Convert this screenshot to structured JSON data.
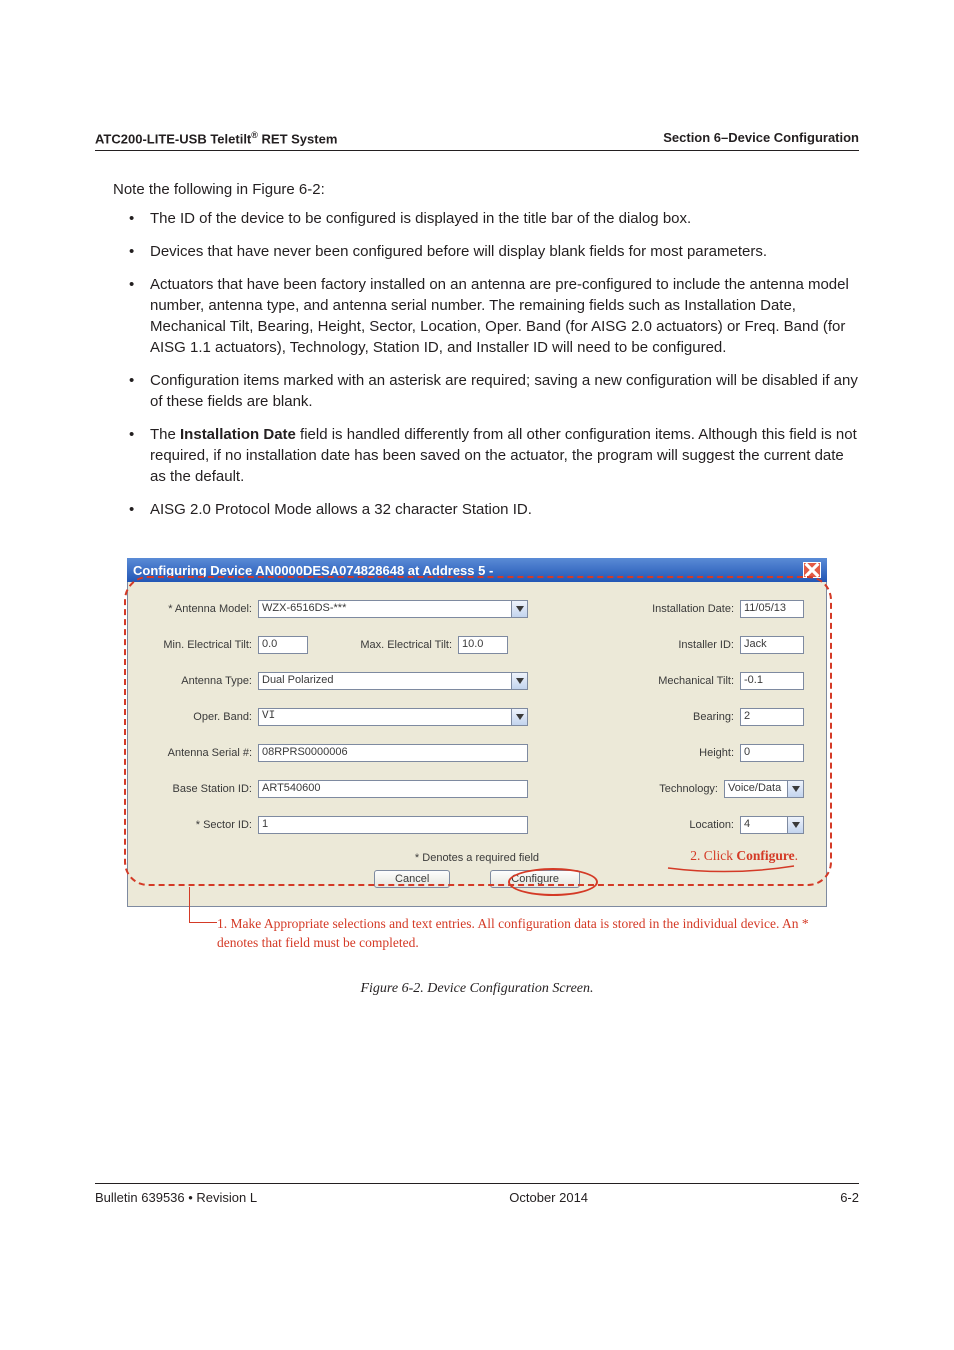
{
  "header": {
    "left_a": "ATC200-LITE-USB Teletilt",
    "left_sup": "®",
    "left_b": " RET System",
    "right": "Section 6–Device Configuration"
  },
  "intro": "Note the following in Figure 6-2:",
  "notes": [
    "The ID of the device to be configured is displayed in the title bar of the dialog box.",
    "Devices that have never been configured before will display blank fields for most parameters.",
    "Actuators that have been factory installed on an antenna are pre-configured to include the antenna model number, antenna type, and antenna serial number. The remaining fields such as Installation Date, Mechanical Tilt, Bearing, Height, Sector, Location, Oper. Band (for AISG 2.0 actuators) or Freq. Band (for AISG 1.1 actuators), Technology, Station ID, and Installer ID will need to be configured.",
    "Configuration items marked with an asterisk are required; saving a new configuration will be disabled if any of these fields are blank.",
    "__BOLD__",
    "AISG 2.0 Protocol Mode allows a 32 character Station ID."
  ],
  "note5_pre": "The ",
  "note5_bold": "Installation Date",
  "note5_post": " field is handled differently from all other configuration items. Although this field is not required, if no installation date has been saved on the actuator, the program will suggest the current date as the default.",
  "dialog": {
    "title": "Configuring Device AN0000DESA074828648 at Address 5 -",
    "labels": {
      "antenna_model": "* Antenna Model:",
      "install_date": "Installation Date:",
      "min_tilt": "Min. Electrical Tilt:",
      "max_tilt": "Max. Electrical Tilt:",
      "installer_id": "Installer ID:",
      "antenna_type": "Antenna Type:",
      "mech_tilt": "Mechanical Tilt:",
      "oper_band": "Oper. Band:",
      "bearing": "Bearing:",
      "serial": "Antenna Serial #:",
      "height": "Height:",
      "base_station": "Base Station ID:",
      "technology": "Technology:",
      "sector": "* Sector ID:",
      "location": "Location:"
    },
    "values": {
      "antenna_model": "WZX-6516DS-***",
      "install_date": "11/05/13",
      "min_tilt": "0.0",
      "max_tilt": "10.0",
      "installer_id": "Jack",
      "antenna_type": "Dual Polarized",
      "mech_tilt": "-0.1",
      "oper_band": "VI",
      "bearing": "2",
      "serial": "08RPRS0000006",
      "height": "0",
      "base_station": "ART540600",
      "technology": "Voice/Data",
      "sector": "1",
      "location": "4"
    },
    "req_note": "* Denotes a required field",
    "buttons": {
      "cancel": "Cancel",
      "configure": "Configure"
    }
  },
  "annot": {
    "right_pre": "2. Click ",
    "right_bold": "Configure",
    "right_post": ".",
    "below": "1. Make Appropriate selections and text entries.  All configuration data is stored in the individual device.  An * denotes that field must be completed."
  },
  "fig_caption": "Figure 6-2. Device Configuration Screen.",
  "footer": {
    "left": "Bulletin 639536  •  Revision L",
    "center": "October 2014",
    "right": "6-2"
  }
}
